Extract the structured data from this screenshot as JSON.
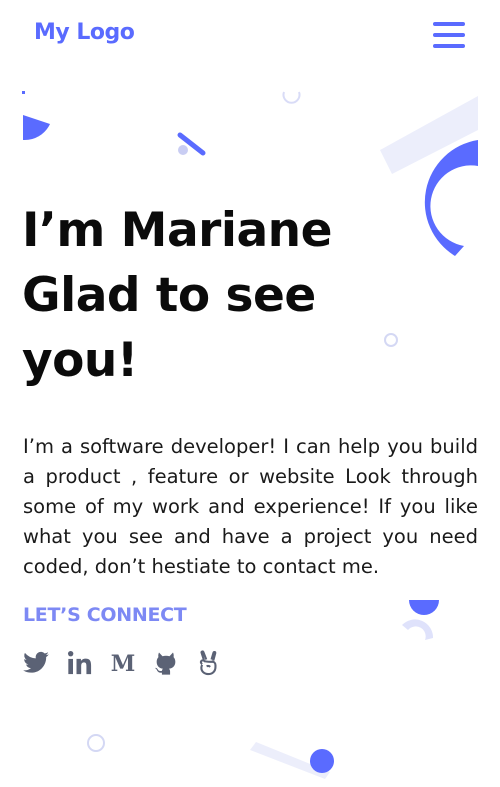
{
  "header": {
    "logo_text": "My Logo",
    "menu_icon": "hamburger-menu-icon"
  },
  "hero": {
    "headline_lines": [
      "I’m Mariane",
      "Glad to see",
      "you!"
    ],
    "intro": "I’m a software developer! I can help you build a product , feature or website Look through some of my work and experience! If you like what you see and have a project you need coded, don’t hestiate to contact me."
  },
  "connect": {
    "label": "LET’S CONNECT",
    "links": [
      {
        "icon": "twitter-icon"
      },
      {
        "icon": "linkedin-icon"
      },
      {
        "icon": "medium-icon"
      },
      {
        "icon": "github-icon"
      },
      {
        "icon": "angellist-icon"
      }
    ]
  },
  "colors": {
    "accent": "#5a6bff",
    "accent_light": "#e8eafb",
    "connect_label": "#7d89f4",
    "icon_gray": "#5b6275",
    "text": "#111111"
  }
}
